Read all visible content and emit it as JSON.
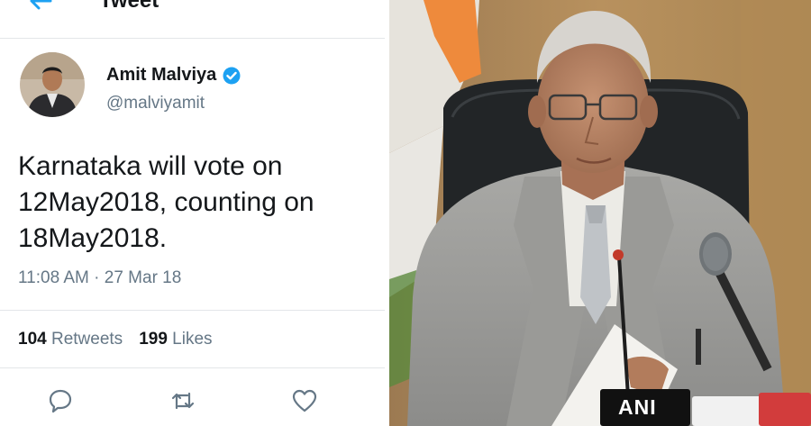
{
  "header": {
    "title": "Tweet",
    "back_icon": "arrow-left-icon"
  },
  "author": {
    "name": "Amit Malviya",
    "handle": "@malviyamit",
    "verified": true,
    "verified_color": "#1da1f2"
  },
  "tweet": {
    "text_lines": [
      "Karnataka will vote on",
      "12May2018, counting on",
      "18May2018."
    ],
    "time": "11:08 AM",
    "separator": "·",
    "date": "27 Mar 18"
  },
  "stats": {
    "retweets_count": "104",
    "retweets_label": "Retweets",
    "likes_count": "199",
    "likes_label": "Likes"
  },
  "actions": {
    "reply_icon": "reply-icon",
    "retweet_icon": "retweet-icon",
    "like_icon": "heart-icon"
  },
  "photo": {
    "mic_label": "ANI",
    "colors": {
      "wall": "#b58f5c",
      "suit": "#9b9b98",
      "flag_saffron": "#ee8a3c",
      "chair": "#1f2224"
    }
  }
}
